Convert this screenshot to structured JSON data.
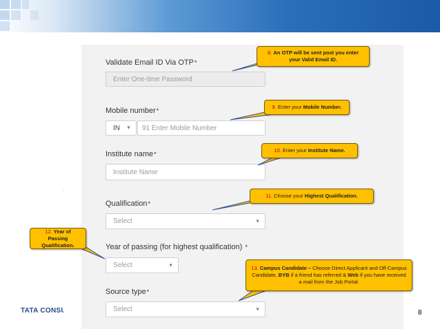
{
  "fields": {
    "otp": {
      "label": "Validate Email ID Via OTP",
      "required_mark": "*",
      "placeholder": "Enter One-time Password"
    },
    "mobile": {
      "label": "Mobile number",
      "required_mark": "*",
      "country_code": "IN",
      "placeholder": "91 Enter Mobile Number"
    },
    "institute": {
      "label": "Institute name",
      "required_mark": "*",
      "placeholder": "Institute Name"
    },
    "qualification": {
      "label": "Qualification",
      "required_mark": "*",
      "selected": "Select"
    },
    "year": {
      "label": "Year of passing (for highest qualification)",
      "required_mark": "*",
      "selected": "Select"
    },
    "source": {
      "label": "Source type",
      "required_mark": "*",
      "selected": "Select"
    }
  },
  "callouts": {
    "c8": {
      "num": "8.",
      "text": "An OTP will be sent post you enter your Valid Email ID."
    },
    "c9": {
      "num": "9.",
      "text_pre": "Enter your ",
      "text_bold": "Mobile Number."
    },
    "c10": {
      "num": "10.",
      "text_pre": "Enter your ",
      "text_bold": "Institute Name."
    },
    "c11": {
      "num": "11.",
      "text_pre": "Choose your ",
      "text_bold": "Highest Qualification."
    },
    "c12": {
      "num": "12.",
      "text": "Year of Passing Qualification."
    },
    "c13": {
      "num": "13.",
      "bold1": "Campus Candidate –",
      "text1": "Choose Direct Applicant and Off Campus Candidate,",
      "bold2": "BYB",
      "text2": "if a friend has referred &",
      "bold3": "Web",
      "text3": "if you have received a mail from the Job Portal."
    }
  },
  "footer": {
    "logo_text": "TATA CONSU",
    "page_number": "8"
  },
  "colors": {
    "callout_fill": "#ffc000",
    "callout_number": "#c00000",
    "pointer_line": "#2f4fa0",
    "brand_blue": "#1a5aa6"
  }
}
